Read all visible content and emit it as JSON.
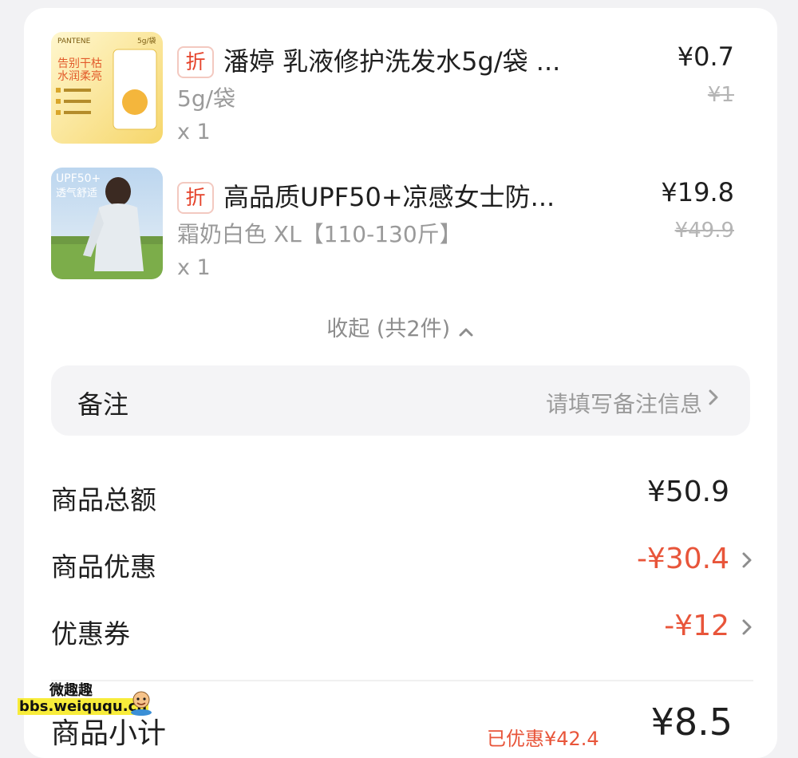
{
  "items": [
    {
      "tag": "折",
      "title": "潘婷 乳液修护洗发水5g/袋 ...",
      "spec": "5g/袋",
      "qty": "x 1",
      "price": "¥0.7",
      "original_price": "¥1",
      "thumb": {
        "brand": "PANTENE",
        "badge": "5g/袋",
        "text1": "告别干枯",
        "text2": "水润柔亮"
      }
    },
    {
      "tag": "折",
      "title": "高品质UPF50+凉感女士防...",
      "spec": "霜奶白色 XL【110-130斤】",
      "qty": "x 1",
      "price": "¥19.8",
      "original_price": "¥49.9",
      "thumb": {
        "text1": "UPF50+",
        "text2": "透气舒适"
      }
    }
  ],
  "collapse": {
    "label": "收起 (共2件)"
  },
  "remark": {
    "label": "备注",
    "placeholder": "请填写备注信息"
  },
  "summary": {
    "total_label": "商品总额",
    "total_value": "¥50.9",
    "discount_label": "商品优惠",
    "discount_value": "-¥30.4",
    "coupon_label": "优惠券",
    "coupon_value": "-¥12"
  },
  "subtotal": {
    "label": "商品小计",
    "saved": "已优惠¥42.4",
    "value": "¥8.5"
  },
  "watermark": {
    "line1": "微趣趣",
    "line2": "bbs.weiququ.cn"
  },
  "colors": {
    "accent_red": "#e8553a",
    "tag_red": "#e5432b",
    "muted": "#9a9a9a"
  }
}
